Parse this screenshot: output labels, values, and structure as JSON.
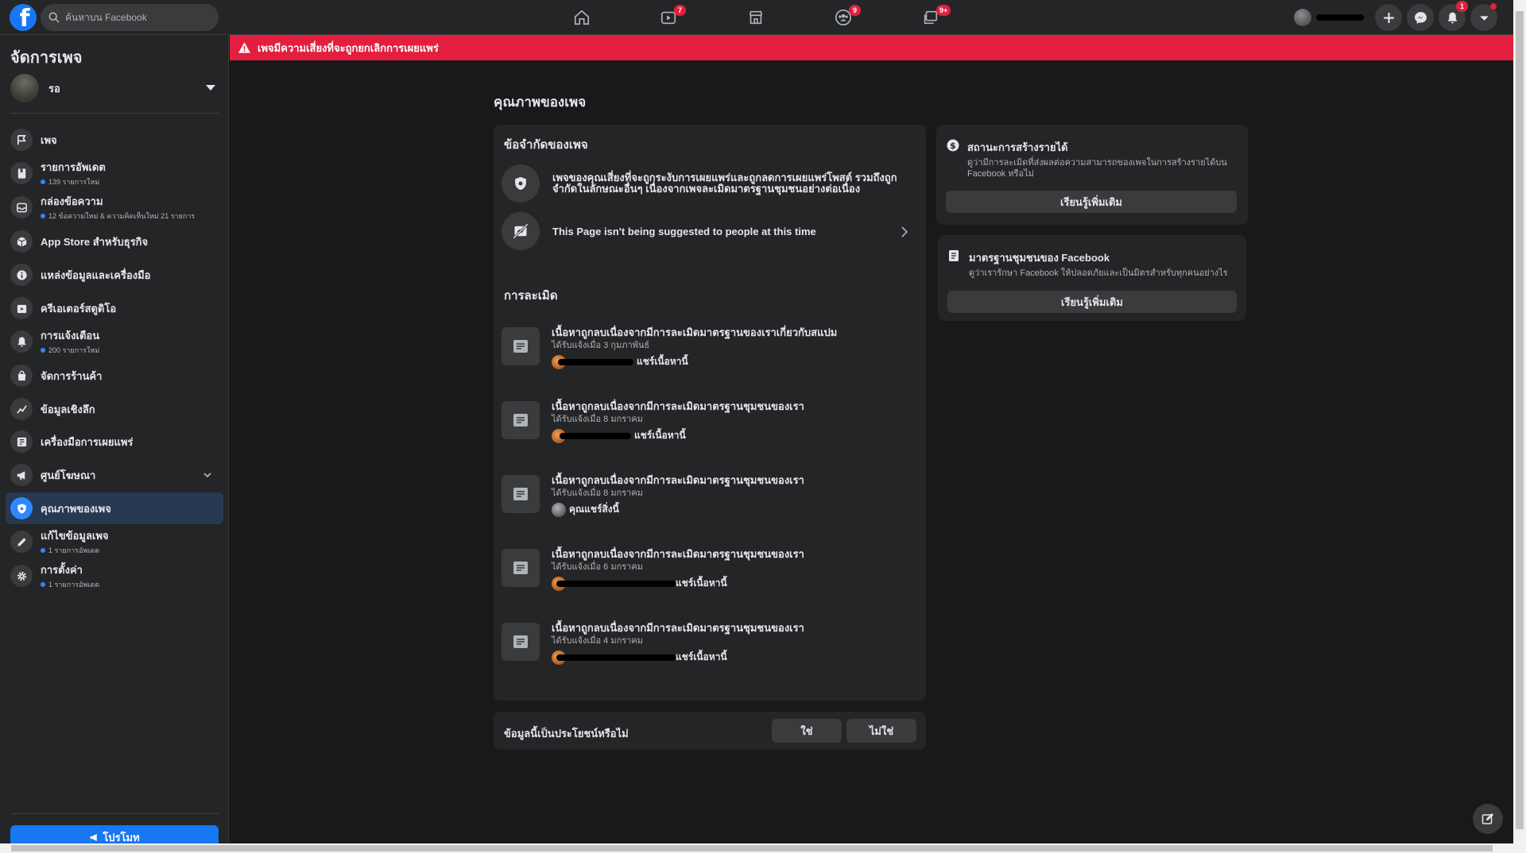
{
  "topbar": {
    "logo": "f",
    "search_placeholder": "ค้นหาบน Facebook",
    "badges": {
      "watch": "7",
      "groups": "9",
      "pages": "9+",
      "notifications": "1"
    }
  },
  "sidebar": {
    "title": "จัดการเพจ",
    "page_name": "รอ",
    "items": [
      {
        "label": "เพจ",
        "sub": ""
      },
      {
        "label": "รายการอัพเดต",
        "sub": "139 รายการใหม่"
      },
      {
        "label": "กล่องข้อความ",
        "sub": "12 ข้อความใหม่ & ความคิดเห็นใหม่ 21 รายการ"
      },
      {
        "label": "App Store สำหรับธุรกิจ",
        "sub": ""
      },
      {
        "label": "แหล่งข้อมูลและเครื่องมือ",
        "sub": ""
      },
      {
        "label": "ครีเอเตอร์สตูดิโอ",
        "sub": ""
      },
      {
        "label": "การแจ้งเตือน",
        "sub": "200 รายการใหม่"
      },
      {
        "label": "จัดการร้านค้า",
        "sub": ""
      },
      {
        "label": "ข้อมูลเชิงลึก",
        "sub": ""
      },
      {
        "label": "เครื่องมือการเผยแพร่",
        "sub": ""
      },
      {
        "label": "ศูนย์โฆษณา",
        "sub": ""
      },
      {
        "label": "คุณภาพของเพจ",
        "sub": ""
      },
      {
        "label": "แก้ไขข้อมูลเพจ",
        "sub": "1 รายการอัพเดต"
      },
      {
        "label": "การตั้งค่า",
        "sub": "1 รายการอัพเดต"
      }
    ],
    "promote_label": "โปรโมท"
  },
  "alert": {
    "text": "เพจมีความเสี่ยงที่จะถูกยกเลิกการเผยแพร่"
  },
  "main": {
    "title": "คุณภาพของเพจ",
    "restrictions": {
      "title": "ข้อจำกัดของเพจ",
      "risk_text_line1": "เพจของคุณเสี่ยงที่จะถูกระงับการเผยแพร่และถูกลดการเผยแพร่โพสต์ รวมถึงถูก",
      "risk_text_line2": "จำกัดในลักษณะอื่นๆ เนื่องจากเพจละเมิดมาตรฐานชุมชนอย่างต่อเนื่อง",
      "suggestion_text": "This Page isn't being suggested to people at this time"
    },
    "violations": {
      "title": "การละเมิด",
      "items": [
        {
          "title": "เนื้อหาถูกลบเนื่องจากมีการละเมิดมาตรฐานของเราเกี่ยวกับสแปม",
          "date": "ได้รับแจ้งเมื่อ 3 กุมภาพันธ์",
          "share": "แชร์เนื้อหานี้"
        },
        {
          "title": "เนื้อหาถูกลบเนื่องจากมีการละเมิดมาตรฐานชุมชนของเรา",
          "date": "ได้รับแจ้งเมื่อ 8 มกราคม",
          "share": "แชร์เนื้อหานี้"
        },
        {
          "title": "เนื้อหาถูกลบเนื่องจากมีการละเมิดมาตรฐานชุมชนของเรา",
          "date": "ได้รับแจ้งเมื่อ 8 มกราคม",
          "share": "คุณแชร์สิ่งนี้"
        },
        {
          "title": "เนื้อหาถูกลบเนื่องจากมีการละเมิดมาตรฐานชุมชนของเรา",
          "date": "ได้รับแจ้งเมื่อ 6 มกราคม",
          "share": "แชร์เนื้อหานี้"
        },
        {
          "title": "เนื้อหาถูกลบเนื่องจากมีการละเมิดมาตรฐานชุมชนของเรา",
          "date": "ได้รับแจ้งเมื่อ 4 มกราคม",
          "share": "แชร์เนื้อหานี้"
        }
      ]
    },
    "feedback": {
      "question": "ข้อมูลนี้เป็นประโยชน์หรือไม่",
      "yes": "ใช่",
      "no": "ไม่ใช่"
    }
  },
  "right": {
    "monetization": {
      "title": "สถานะการสร้างรายได้",
      "desc_line1": "ดูว่ามีการละเมิดที่ส่งผลต่อความสามารถของเพจในการสร้างรายได้บน",
      "desc_line2": "Facebook หรือไม่",
      "button": "เรียนรู้เพิ่มเติม"
    },
    "standards": {
      "title": "มาตรฐานชุมชนของ Facebook",
      "desc": "ดูว่าเรารักษา Facebook ให้ปลอดภัยและเป็นมิตรสำหรับทุกคนอย่างไร",
      "button": "เรียนรู้เพิ่มเติม"
    }
  },
  "colors": {
    "accent": "#1877f2",
    "alert": "#e41e3f",
    "background": "#18191a",
    "card": "#242526"
  }
}
